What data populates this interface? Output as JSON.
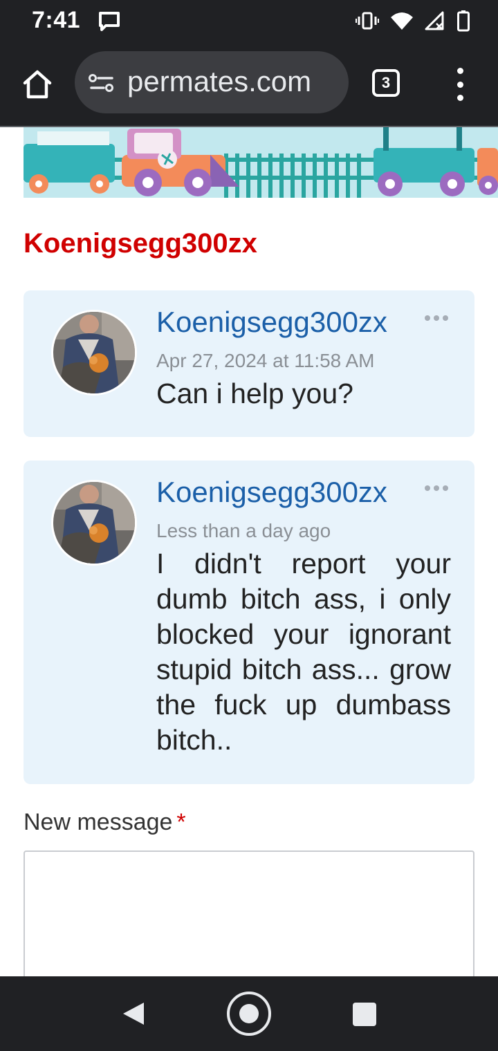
{
  "status_bar": {
    "time": "7:41"
  },
  "browser": {
    "url": "permates.com",
    "tab_count": "3"
  },
  "thread": {
    "title": "Koenigsegg300zx"
  },
  "messages": [
    {
      "author": "Koenigsegg300zx",
      "date": "Apr 27, 2024 at 11:58 AM",
      "body": "Can i help you?"
    },
    {
      "author": "Koenigsegg300zx",
      "date": "Less than a day ago",
      "body": "I didn't report your dumb bitch ass, i only blocked your ignorant stupid bitch ass... grow the fuck up dumbass bitch.."
    }
  ],
  "composer": {
    "label": "New message",
    "required_mark": "*",
    "value": ""
  },
  "colors": {
    "title_red": "#d00000",
    "author_blue": "#1b5fa8",
    "message_bg": "#e8f3fb"
  }
}
